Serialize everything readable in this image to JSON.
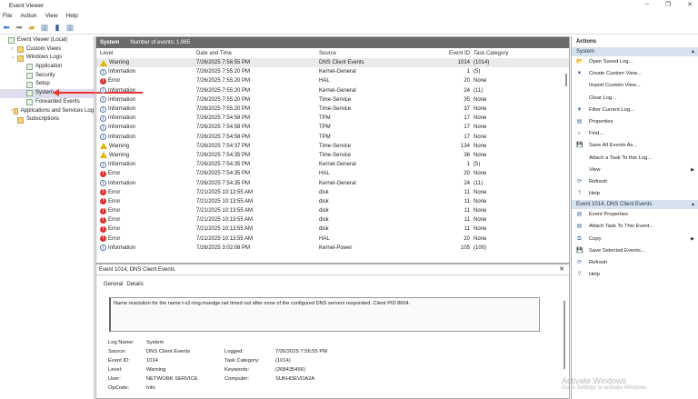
{
  "window": {
    "title": "Event Viewer",
    "controls": [
      "–",
      "❐",
      "✕"
    ]
  },
  "menu": [
    "File",
    "Action",
    "View",
    "Help"
  ],
  "toolbar": [
    "back-icon",
    "forward-icon",
    "folder-icon",
    "console-icon",
    "help-icon",
    "panel-icon"
  ],
  "tree": [
    {
      "label": "Event Viewer (Local)",
      "indent": 0,
      "icon": "computer"
    },
    {
      "label": "Custom Views",
      "indent": 1,
      "icon": "folder",
      "expander": "›"
    },
    {
      "label": "Windows Logs",
      "indent": 1,
      "icon": "folder",
      "expander": "⌄"
    },
    {
      "label": "Application",
      "indent": 2,
      "icon": "log"
    },
    {
      "label": "Security",
      "indent": 2,
      "icon": "log"
    },
    {
      "label": "Setup",
      "indent": 2,
      "icon": "log"
    },
    {
      "label": "System",
      "indent": 2,
      "icon": "log",
      "selected": true
    },
    {
      "label": "Forwarded Events",
      "indent": 2,
      "icon": "log"
    },
    {
      "label": "Applications and Services Log",
      "indent": 1,
      "icon": "folder",
      "expander": "›"
    },
    {
      "label": "Subscriptions",
      "indent": 1,
      "icon": "folder"
    }
  ],
  "log": {
    "name": "System",
    "count_label": "Number of events: 1,965"
  },
  "columns": [
    "Level",
    "Date and Time",
    "Source",
    "Event ID",
    "Task Category"
  ],
  "events": [
    [
      "Warning",
      "7/26/2025 7:56:55 PM",
      "DNS Client Events",
      "1014",
      "(1014)"
    ],
    [
      "Information",
      "7/26/2025 7:55:20 PM",
      "Kernel-General",
      "1",
      "(5)"
    ],
    [
      "Error",
      "7/26/2025 7:55:20 PM",
      "HAL",
      "20",
      "None"
    ],
    [
      "Information",
      "7/26/2025 7:55:20 PM",
      "Kernel-General",
      "24",
      "(11)"
    ],
    [
      "Information",
      "7/26/2025 7:55:20 PM",
      "Time-Service",
      "35",
      "None"
    ],
    [
      "Information",
      "7/26/2025 7:55:20 PM",
      "Time-Service",
      "37",
      "None"
    ],
    [
      "Information",
      "7/26/2025 7:54:58 PM",
      "TPM",
      "17",
      "None"
    ],
    [
      "Information",
      "7/26/2025 7:54:58 PM",
      "TPM",
      "17",
      "None"
    ],
    [
      "Information",
      "7/26/2025 7:54:58 PM",
      "TPM",
      "17",
      "None"
    ],
    [
      "Warning",
      "7/26/2025 7:54:37 PM",
      "Time-Service",
      "134",
      "None"
    ],
    [
      "Warning",
      "7/26/2025 7:54:35 PM",
      "Time-Service",
      "36",
      "None"
    ],
    [
      "Information",
      "7/26/2025 7:54:35 PM",
      "Kernel-General",
      "1",
      "(5)"
    ],
    [
      "Error",
      "7/26/2025 7:54:35 PM",
      "HAL",
      "20",
      "None"
    ],
    [
      "Information",
      "7/26/2025 7:54:35 PM",
      "Kernel-General",
      "24",
      "(11)"
    ],
    [
      "Error",
      "7/21/2025 10:13:55 AM",
      "disk",
      "11",
      "None"
    ],
    [
      "Error",
      "7/21/2025 10:13:55 AM",
      "disk",
      "11",
      "None"
    ],
    [
      "Error",
      "7/21/2025 10:13:55 AM",
      "disk",
      "11",
      "None"
    ],
    [
      "Error",
      "7/21/2025 10:13:55 AM",
      "disk",
      "11",
      "None"
    ],
    [
      "Error",
      "7/21/2025 10:13:55 AM",
      "disk",
      "11",
      "None"
    ],
    [
      "Error",
      "7/21/2025 10:13:55 AM",
      "HAL",
      "20",
      "None"
    ],
    [
      "Information",
      "7/26/2025 3:02:08 PM",
      "Kernel-Power",
      "105",
      "(100)"
    ]
  ],
  "detail": {
    "title": "Event 1014, DNS Client Events",
    "close": "✕",
    "tabs": [
      "General",
      "Details"
    ],
    "message": "Name resolution for the name t-s2-ring.msedge.net timed out after none of the configured DNS servers responded. Client PID 8604.",
    "fields": [
      {
        "l": "Log Name:",
        "v": "System",
        "l2": "",
        "v2": ""
      },
      {
        "l": "Source:",
        "v": "DNS Client Events",
        "l2": "Logged:",
        "v2": "7/26/2025 7:56:55 PM"
      },
      {
        "l": "Event ID:",
        "v": "1014",
        "l2": "Task Category:",
        "v2": "(1014)"
      },
      {
        "l": "Level:",
        "v": "Warning",
        "l2": "Keywords:",
        "v2": "(268435456)"
      },
      {
        "l": "User:",
        "v": "NETWORK SERVICE",
        "l2": "Computer:",
        "v2": "SUKHDEVDA2A"
      },
      {
        "l": "OpCode:",
        "v": "Info",
        "l2": "",
        "v2": ""
      }
    ]
  },
  "actions": {
    "header": "Actions",
    "sections": [
      {
        "title": "System",
        "items": [
          {
            "label": "Open Saved Log...",
            "icon": "📂"
          },
          {
            "label": "Create Custom View...",
            "icon": "▼"
          },
          {
            "label": "Import Custom View...",
            "icon": ""
          },
          {
            "label": "Clear Log...",
            "icon": ""
          },
          {
            "label": "Filter Current Log...",
            "icon": "▼"
          },
          {
            "label": "Properties",
            "icon": "▤"
          },
          {
            "label": "Find...",
            "icon": "⌕"
          },
          {
            "label": "Save All Events As...",
            "icon": "💾"
          },
          {
            "label": "Attach a Task To this Log...",
            "icon": ""
          },
          {
            "label": "View",
            "icon": "",
            "submenu": "▶"
          },
          {
            "label": "Refresh",
            "icon": "⟳"
          },
          {
            "label": "Help",
            "icon": "?"
          }
        ]
      },
      {
        "title": "Event 1014, DNS Client Events",
        "items": [
          {
            "label": "Event Properties",
            "icon": "▤"
          },
          {
            "label": "Attach Task To This Event...",
            "icon": "▤"
          },
          {
            "label": "Copy",
            "icon": "⧉",
            "submenu": "▶"
          },
          {
            "label": "Save Selected Events...",
            "icon": "💾"
          },
          {
            "label": "Refresh",
            "icon": "⟳"
          },
          {
            "label": "Help",
            "icon": "?"
          }
        ]
      }
    ]
  },
  "watermark": {
    "line1": "Activate Windows",
    "line2": "Go to Settings to activate Windows."
  },
  "colors": {
    "header_bar": "#6b6b6b",
    "section": "#d6e2ee",
    "annotation_arrow": "#e33333",
    "error": "#dd3333",
    "warning": "#e0b400",
    "info": "#5577aa"
  }
}
